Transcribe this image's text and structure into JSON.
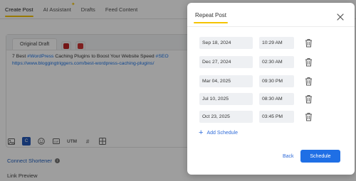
{
  "nav": {
    "tabs": [
      {
        "label": "Create Post"
      },
      {
        "label": "AI Assistant"
      },
      {
        "label": "Drafts"
      },
      {
        "label": "Feed Content"
      }
    ]
  },
  "editor": {
    "tab_original": "Original Draft",
    "post_line1_prefix": "7 Best ",
    "post_hashtag1": "#WordPress",
    "post_line1_middle": " Caching Plugins to Boost Your Website Speed ",
    "post_hashtag2": "#SEO",
    "post_link": "https://www.bloggingtriggers.com/best-wordpress-caching-plugins/"
  },
  "toolbar": {
    "utm_label": "UTM",
    "icons": [
      "canva-icon",
      "emoji-icon",
      "gif-icon",
      "hashtag-icon",
      "grid-icon"
    ]
  },
  "connect_shortener": "Connect Shortener",
  "link_preview": "Link Preview",
  "modal": {
    "title": "Repeat Post",
    "schedules": [
      {
        "date": "Sep 18, 2024",
        "time": "10:29 AM"
      },
      {
        "date": "Dec 27, 2024",
        "time": "02:30 AM"
      },
      {
        "date": "Mar 04, 2025",
        "time": "09:30 PM"
      },
      {
        "date": "Jul 10, 2025",
        "time": "08:30 AM"
      },
      {
        "date": "Oct 23, 2025",
        "time": "03:45 PM"
      }
    ],
    "add_schedule_label": "Add Schedule",
    "back_label": "Back",
    "schedule_label": "Schedule"
  },
  "colors": {
    "accent_yellow": "#f5c400",
    "primary_blue": "#1f6fe5",
    "link_blue": "#2f6bd8"
  }
}
